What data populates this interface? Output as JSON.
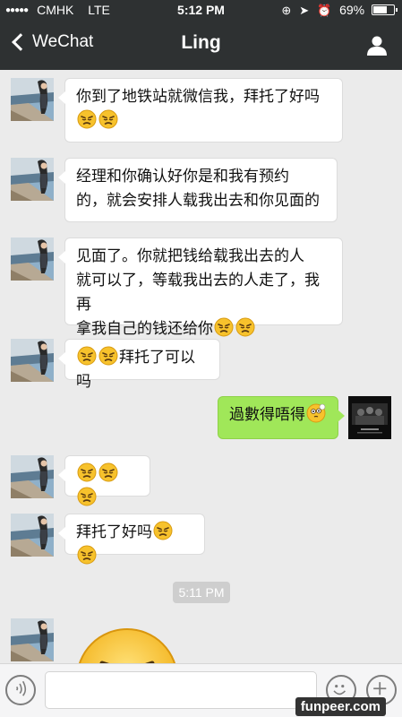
{
  "status_bar": {
    "carrier": "CMHK",
    "network": "LTE",
    "time": "5:12 PM",
    "battery": "69%",
    "battery_level": 0.69
  },
  "nav": {
    "back_label": "WeChat",
    "title": "Ling"
  },
  "messages": [
    {
      "text": "你到了地铁站就微信我，拜托了好吗"
    },
    {
      "text_line1": "经理和你确认好你是和我有预约",
      "text_line2": "的，就会安排人载我出去和你见面的"
    },
    {
      "text_line1": "见面了。你就把钱给载我出去的人",
      "text_line2": "就可以了，等载我出去的人走了，我再",
      "text_line3": "拿我自己的钱还给你"
    },
    {
      "text": "拜托了可以吗"
    },
    {
      "text": "過數得唔得"
    },
    {
      "text": ""
    },
    {
      "text": "拜托了好吗"
    }
  ],
  "timestamp": "5:11 PM",
  "input": {
    "placeholder": ""
  },
  "colors": {
    "bar": "#2e3132",
    "outgoing": "#a0e759",
    "background": "#ebebeb"
  },
  "icons": [
    "back-chevron",
    "profile-icon",
    "voice-icon",
    "smiley-icon",
    "plus-icon",
    "angry-emoji",
    "thinking-emoji"
  ],
  "watermark": "funpeer.com"
}
